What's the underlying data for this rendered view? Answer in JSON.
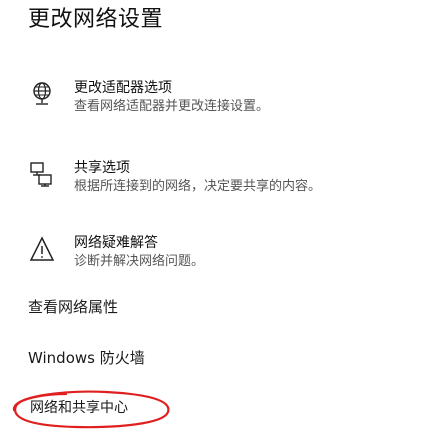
{
  "page": {
    "title": "更改网络设置"
  },
  "items": [
    {
      "title": "更改适配器选项",
      "desc": "查看网络适配器并更改连接设置。",
      "icon": "adapter-globe-icon"
    },
    {
      "title": "共享选项",
      "desc": "根据所连接到的网络，决定要共享的内容。",
      "icon": "sharing-computer-icon"
    },
    {
      "title": "网络疑难解答",
      "desc": "诊断并解决网络问题。",
      "icon": "warning-triangle-icon"
    }
  ],
  "links": [
    {
      "label": "查看网络属性"
    },
    {
      "label": "Windows 防火墙"
    },
    {
      "label": "网络和共享中心"
    }
  ],
  "annotation": {
    "color": "#e02020",
    "shape": "ellipse"
  }
}
